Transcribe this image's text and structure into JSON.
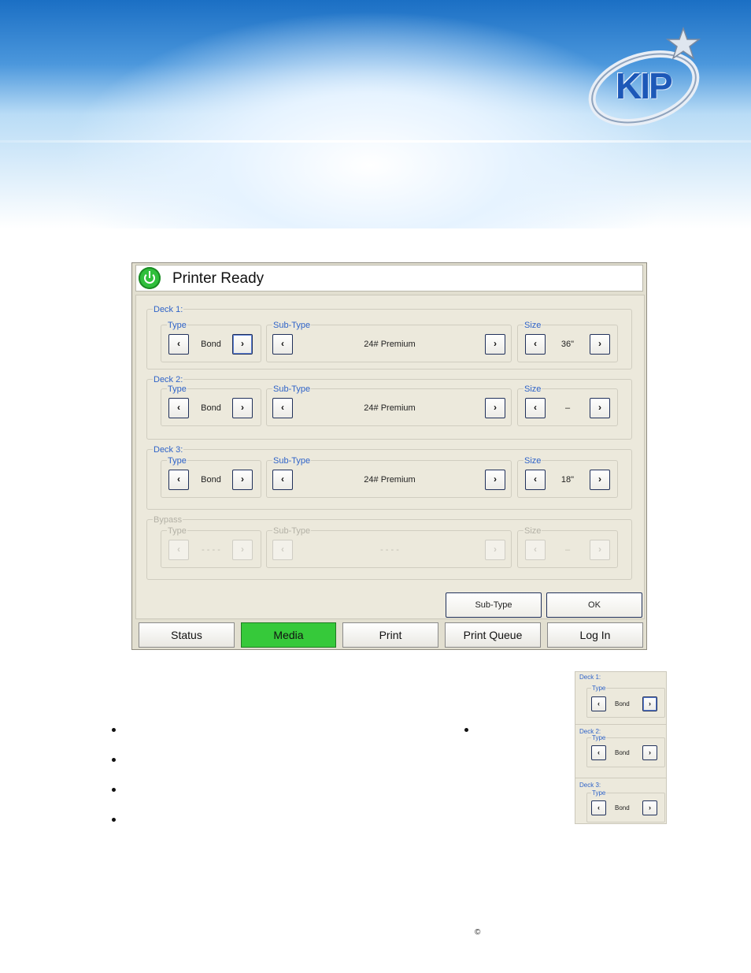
{
  "logo": {
    "text": "KIP"
  },
  "screen": {
    "title": "Printer Ready",
    "decks": [
      {
        "label": "Deck 1:",
        "type_label": "Type",
        "type_value": "Bond",
        "subtype_label": "Sub-Type",
        "subtype_value": "24# Premium",
        "size_label": "Size",
        "size_value": "36\"",
        "prev": "‹",
        "next": "›"
      },
      {
        "label": "Deck 2:",
        "type_label": "Type",
        "type_value": "Bond",
        "subtype_label": "Sub-Type",
        "subtype_value": "24# Premium",
        "size_label": "Size",
        "size_value": "–",
        "prev": "‹",
        "next": "›"
      },
      {
        "label": "Deck 3:",
        "type_label": "Type",
        "type_value": "Bond",
        "subtype_label": "Sub-Type",
        "subtype_value": "24# Premium",
        "size_label": "Size",
        "size_value": "18\"",
        "prev": "‹",
        "next": "›"
      },
      {
        "label": "Bypass",
        "type_label": "Type",
        "type_value": "- - - -",
        "subtype_label": "Sub-Type",
        "subtype_value": "- - - -",
        "size_label": "Size",
        "size_value": "–",
        "prev": "‹",
        "next": "›"
      }
    ],
    "subtype_button": "Sub-Type",
    "ok_button": "OK",
    "nav": [
      "Status",
      "Media",
      "Print",
      "Print Queue",
      "Log In"
    ],
    "active_nav": "Media",
    "colors": {
      "active_tab": "#36c93a",
      "power": "#2fbf3c",
      "legend": "#2f63c8"
    }
  },
  "thumbnail": {
    "decks": [
      {
        "label": "Deck 1:",
        "type_label": "Type",
        "type_value": "Bond",
        "prev": "‹",
        "next": "›"
      },
      {
        "label": "Deck 2:",
        "type_label": "Type",
        "type_value": "Bond",
        "prev": "‹",
        "next": "›"
      },
      {
        "label": "Deck 3:",
        "type_label": "Type",
        "type_value": "Bond",
        "prev": "‹",
        "next": "›"
      }
    ]
  },
  "footer": {
    "copyright": "©"
  }
}
